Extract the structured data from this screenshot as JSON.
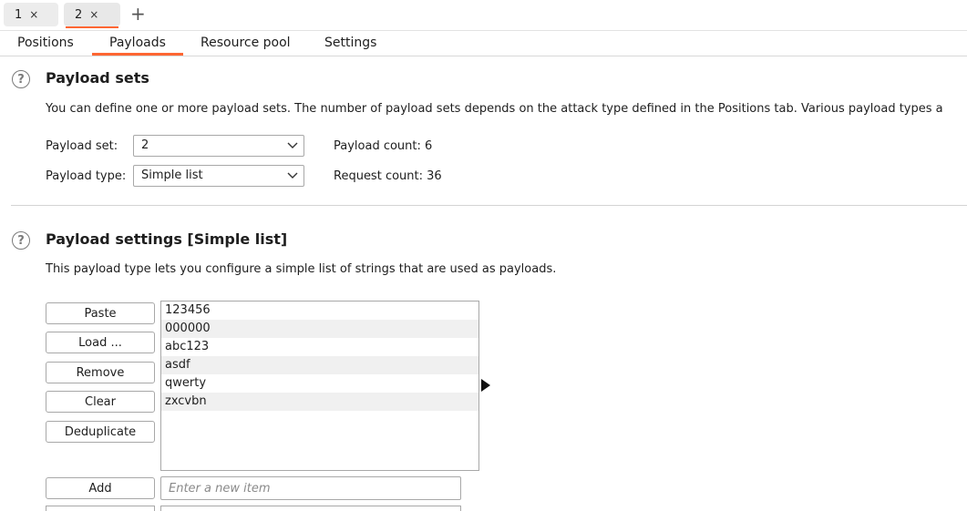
{
  "request_tabs": [
    {
      "label": "1",
      "close": "×"
    },
    {
      "label": "2",
      "close": "×"
    }
  ],
  "new_tab_label": "+",
  "section_tabs": [
    "Positions",
    "Payloads",
    "Resource pool",
    "Settings"
  ],
  "payload_sets": {
    "title": "Payload sets",
    "description": "You can define one or more payload sets. The number of payload sets depends on the attack type defined in the Positions tab. Various payload types a",
    "set_label": "Payload set:",
    "set_value": "2",
    "type_label": "Payload type:",
    "type_value": "Simple list",
    "payload_count": "Payload count: 6",
    "request_count": "Request count: 36"
  },
  "payload_settings": {
    "title": "Payload settings [Simple list]",
    "description": "This payload type lets you configure a simple list of strings that are used as payloads.",
    "buttons": {
      "paste": "Paste",
      "load": "Load ...",
      "remove": "Remove",
      "clear": "Clear",
      "deduplicate": "Deduplicate",
      "add": "Add"
    },
    "items": [
      "123456",
      "000000",
      "abc123",
      "asdf",
      "qwerty",
      "zxcvbn"
    ],
    "new_item_placeholder": "Enter a new item"
  },
  "colors": {
    "accent": "#ff6633"
  }
}
